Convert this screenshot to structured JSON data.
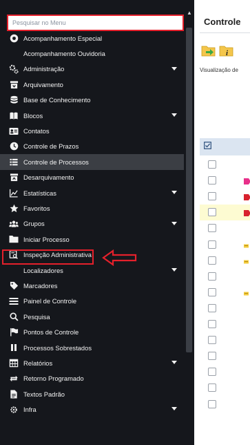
{
  "search": {
    "placeholder": "Pesquisar no Menu"
  },
  "sidebar": {
    "items": [
      {
        "label": "Acompanhamento Especial",
        "icon": "eye-icon",
        "has_submenu": false
      },
      {
        "label": "Acompanhamento Ouvidoria",
        "icon": "",
        "has_submenu": false
      },
      {
        "label": "Administração",
        "icon": "gears-icon",
        "has_submenu": true
      },
      {
        "label": "Arquivamento",
        "icon": "archive-box-icon",
        "has_submenu": false
      },
      {
        "label": "Base de Conhecimento",
        "icon": "database-icon",
        "has_submenu": false
      },
      {
        "label": "Blocos",
        "icon": "book-icon",
        "has_submenu": true
      },
      {
        "label": "Contatos",
        "icon": "contact-card-icon",
        "has_submenu": false
      },
      {
        "label": "Controle de Prazos",
        "icon": "clock-icon",
        "has_submenu": false
      },
      {
        "label": "Controle de Processos",
        "icon": "list-icon",
        "has_submenu": false,
        "active": true
      },
      {
        "label": "Desarquivamento",
        "icon": "unarchive-box-icon",
        "has_submenu": false
      },
      {
        "label": "Estatísticas",
        "icon": "line-chart-icon",
        "has_submenu": true
      },
      {
        "label": "Favoritos",
        "icon": "star-icon",
        "has_submenu": false
      },
      {
        "label": "Grupos",
        "icon": "group-icon",
        "has_submenu": true
      },
      {
        "label": "Iniciar Processo",
        "icon": "folder-icon",
        "has_submenu": false,
        "highlighted": true
      },
      {
        "label": "Inspeção Administrativa",
        "icon": "inspection-icon",
        "has_submenu": false
      },
      {
        "label": "Localizadores",
        "icon": "",
        "has_submenu": true
      },
      {
        "label": "Marcadores",
        "icon": "tag-icon",
        "has_submenu": false
      },
      {
        "label": "Painel de Controle",
        "icon": "menu-lines-icon",
        "has_submenu": false
      },
      {
        "label": "Pesquisa",
        "icon": "search-icon",
        "has_submenu": false
      },
      {
        "label": "Pontos de Controle",
        "icon": "flag-icon",
        "has_submenu": false
      },
      {
        "label": "Processos Sobrestados",
        "icon": "pause-icon",
        "has_submenu": false
      },
      {
        "label": "Relatórios",
        "icon": "table-icon",
        "has_submenu": true
      },
      {
        "label": "Retorno Programado",
        "icon": "exchange-icon",
        "has_submenu": false
      },
      {
        "label": "Textos Padrão",
        "icon": "document-icon",
        "has_submenu": false
      },
      {
        "label": "Infra",
        "icon": "infra-icon",
        "has_submenu": true
      }
    ]
  },
  "main": {
    "title": "Controle",
    "view_label": "Visualização de",
    "rows": [
      {
        "marker": ""
      },
      {
        "marker": "pink"
      },
      {
        "marker": "red"
      },
      {
        "marker": "red",
        "highlighted": true
      },
      {
        "marker": ""
      },
      {
        "marker": "yellow"
      },
      {
        "marker": "yellow"
      },
      {
        "marker": ""
      },
      {
        "marker": "yellow"
      },
      {
        "marker": ""
      },
      {
        "marker": ""
      },
      {
        "marker": ""
      },
      {
        "marker": ""
      },
      {
        "marker": ""
      },
      {
        "marker": ""
      },
      {
        "marker": ""
      }
    ]
  },
  "colors": {
    "sidebar_bg": "#15171c",
    "active_item_bg": "#3b3e44",
    "annotation_red": "#e5202b",
    "header_row_bg": "#dbe5f1",
    "highlight_row_bg": "#fdfbd2"
  }
}
